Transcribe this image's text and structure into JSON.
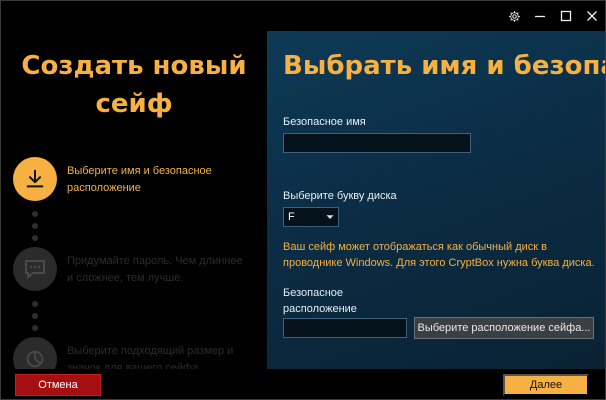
{
  "window": {
    "controls": [
      "gear-icon",
      "minimize-icon",
      "maximize-icon",
      "close-icon"
    ]
  },
  "left": {
    "title_line1": "Создать новый",
    "title_line2": "сейф",
    "steps": [
      {
        "label": "Выберите имя и безопасное расположение",
        "icon": "download-icon",
        "state": "active"
      },
      {
        "label": "Придумайте пароль. Чем длиннее и сложнее, тем лучше.",
        "icon": "password-dialog-icon",
        "state": "inactive"
      },
      {
        "label": "Выберите подходящий размер и значок для вашего сейфа.",
        "icon": "pie-chart-icon",
        "state": "inactive"
      }
    ]
  },
  "right": {
    "title": "Выбрать имя и безопасное расположение",
    "safe_name_label": "Безопасное имя",
    "safe_name_value": "",
    "drive_label": "Выберите букву диска",
    "drive_value": "F",
    "note": "Ваш сейф может отображаться как обычный диск в проводнике Windows. Для этого CryptBox нужна буква диска.",
    "location_label_line1": "Безопасное",
    "location_label_line2": "расположение",
    "location_value": "",
    "browse_label": "Выберите расположение сейфа..."
  },
  "footer": {
    "cancel_label": "Отмена",
    "next_label": "Далее"
  },
  "colors": {
    "accent": "#f6b142",
    "cancel": "#a50f12",
    "panel": "#0e3a57"
  }
}
